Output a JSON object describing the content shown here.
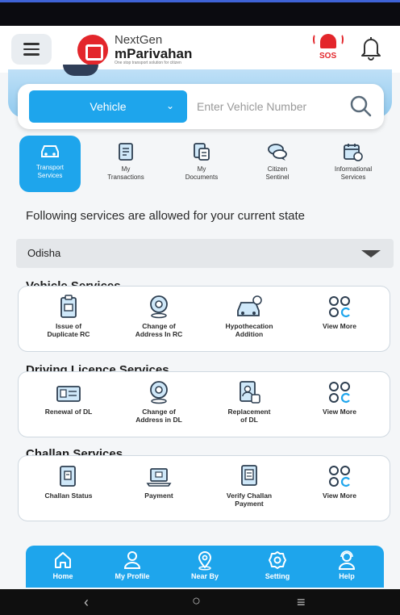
{
  "app": {
    "brand_line1": "NextGen",
    "brand_line2": "mParivahan",
    "brand_tagline": "One stop transport solution for citizen",
    "sos_label": "SOS"
  },
  "search": {
    "type_label": "Vehicle",
    "placeholder": "Enter Vehicle Number"
  },
  "tabs": [
    {
      "label": "Transport\nServices",
      "icon": "car-icon",
      "active": true
    },
    {
      "label": "My\nTransactions",
      "icon": "receipt-icon",
      "active": false
    },
    {
      "label": "My\nDocuments",
      "icon": "documents-icon",
      "active": false
    },
    {
      "label": "Citizen\nSentinel",
      "icon": "chat-icon",
      "active": false
    },
    {
      "label": "Informational\nServices",
      "icon": "calendar-icon",
      "active": false
    }
  ],
  "state": {
    "note": "Following services are allowed for your current state",
    "selected": "Odisha"
  },
  "sections": [
    {
      "title": "Vehicle Services",
      "items": [
        {
          "label": "Issue of\nDuplicate RC",
          "icon": "clipboard-icon"
        },
        {
          "label": "Change of\nAddress In RC",
          "icon": "location-pin-icon"
        },
        {
          "label": "Hypothecation\nAddition",
          "icon": "car-money-icon"
        },
        {
          "label": "View More",
          "icon": "grid-icon"
        }
      ]
    },
    {
      "title": "Driving Licence Services",
      "items": [
        {
          "label": "Renewal of DL",
          "icon": "license-card-icon"
        },
        {
          "label": "Change of\nAddress in DL",
          "icon": "location-pin-icon"
        },
        {
          "label": "Replacement\nof DL",
          "icon": "document-person-icon"
        },
        {
          "label": "View More",
          "icon": "grid-icon"
        }
      ]
    },
    {
      "title": "Challan Services",
      "items": [
        {
          "label": "Challan Status",
          "icon": "challan-icon"
        },
        {
          "label": "Payment",
          "icon": "laptop-icon"
        },
        {
          "label": "Verify Challan\nPayment",
          "icon": "verify-document-icon"
        },
        {
          "label": "View More",
          "icon": "grid-icon"
        }
      ]
    }
  ],
  "bottom_nav": [
    {
      "label": "Home",
      "icon": "home-icon"
    },
    {
      "label": "My Profile",
      "icon": "person-icon"
    },
    {
      "label": "Near By",
      "icon": "location-icon"
    },
    {
      "label": "Setting",
      "icon": "gear-icon"
    },
    {
      "label": "Help",
      "icon": "support-agent-icon"
    }
  ],
  "colors": {
    "accent": "#1ea5ec",
    "brand_red": "#e3262b"
  }
}
